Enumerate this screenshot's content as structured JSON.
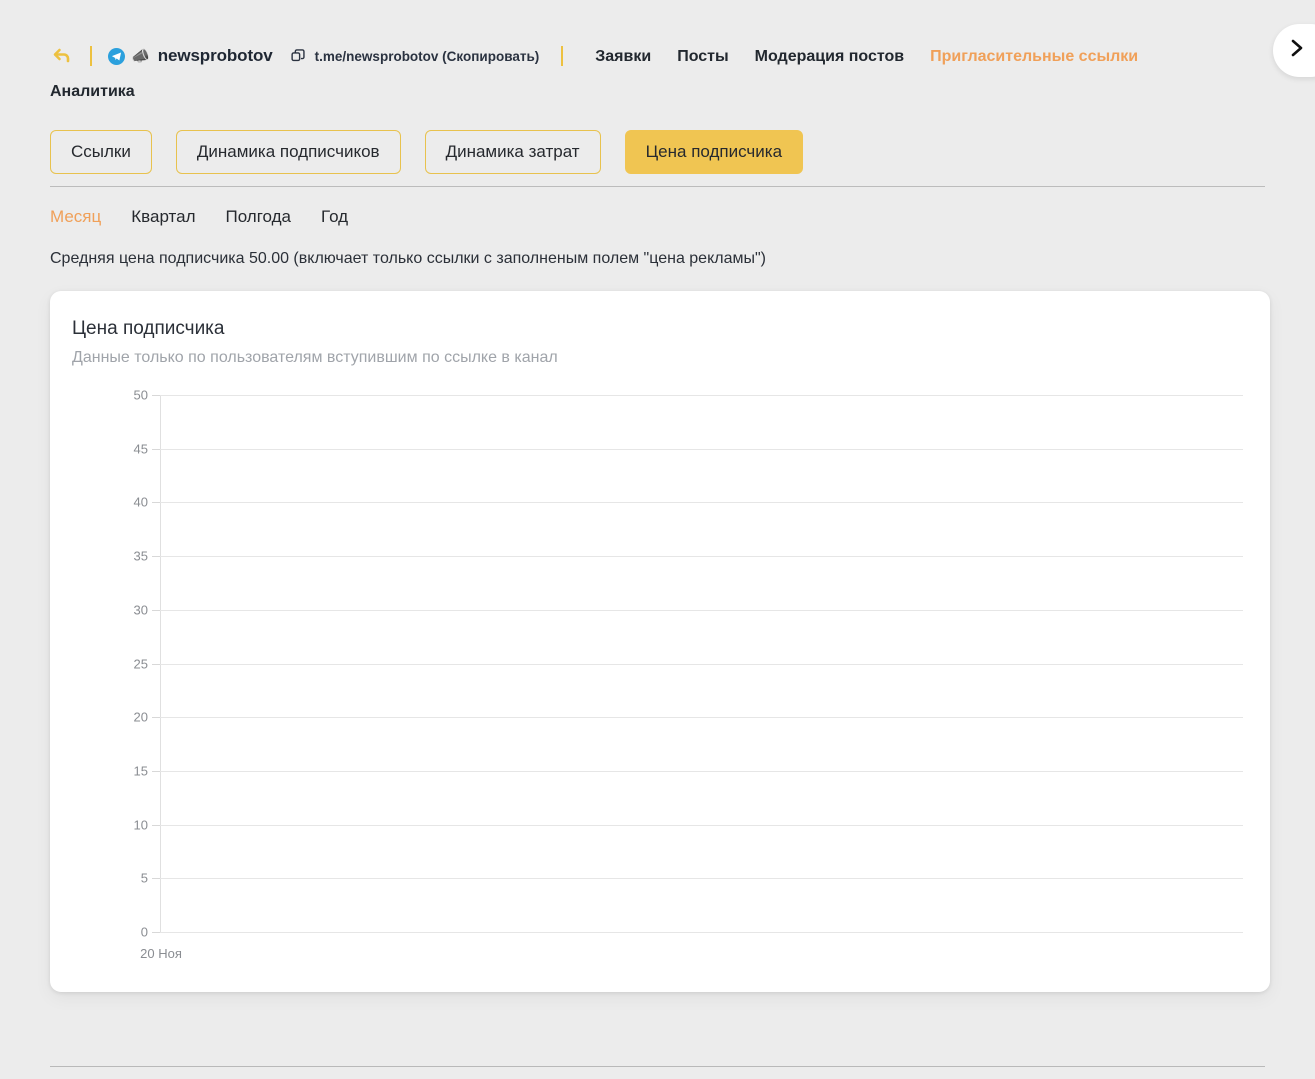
{
  "header": {
    "back_icon": "back-arrow-icon",
    "telegram_icon": "telegram-icon",
    "megaphone_icon": "megaphone-icon",
    "channel_name": "newsprobotov",
    "copy_icon": "copy-icon",
    "channel_link": "t.me/newsprobotov (Скопировать)",
    "nav": [
      {
        "label": "Заявки",
        "active": false
      },
      {
        "label": "Посты",
        "active": false
      },
      {
        "label": "Модерация постов",
        "active": false
      },
      {
        "label": "Пригласительные ссылки",
        "active": true
      }
    ],
    "page_title": "Аналитика",
    "next_icon": "chevron-right-icon"
  },
  "tabs": [
    {
      "label": "Ссылки",
      "active": false
    },
    {
      "label": "Динамика подписчиков",
      "active": false
    },
    {
      "label": "Динамика затрат",
      "active": false
    },
    {
      "label": "Цена подписчика",
      "active": true
    }
  ],
  "periods": [
    {
      "label": "Месяц",
      "active": true
    },
    {
      "label": "Квартал",
      "active": false
    },
    {
      "label": "Полгода",
      "active": false
    },
    {
      "label": "Год",
      "active": false
    }
  ],
  "avg_note": "Средняя цена подписчика 50.00 (включает только ссылки с заполненым полем \"цена рекламы\")",
  "card": {
    "title": "Цена подписчика",
    "subtitle": "Данные только по пользователям вступившим по ссылке в канал"
  },
  "colors": {
    "accent_yellow": "#f0c552",
    "accent_orange": "#f0a059",
    "page_bg": "#ececec",
    "card_bg": "#ffffff",
    "grid": "#e6e6e6",
    "tick_text": "#8a8d92"
  },
  "chart_data": {
    "type": "line",
    "title": "Цена подписчика",
    "subtitle": "Данные только по пользователям вступившим по ссылке в канал",
    "xlabel": "",
    "ylabel": "",
    "x": [
      "20 Ноя"
    ],
    "categories": [
      "20 Ноя"
    ],
    "series": [
      {
        "name": "Цена подписчика",
        "values": []
      }
    ],
    "values": [],
    "ylim": [
      0,
      50
    ],
    "yticks": [
      0,
      5,
      10,
      15,
      20,
      25,
      30,
      35,
      40,
      45,
      50
    ],
    "ytick_labels": [
      "0",
      "5",
      "10",
      "15",
      "20",
      "25",
      "30",
      "35",
      "40",
      "45",
      "50"
    ],
    "xtick_labels": [
      "20 Ноя"
    ],
    "grid": true,
    "legend": false,
    "note": "Нет данных — график пуст"
  }
}
